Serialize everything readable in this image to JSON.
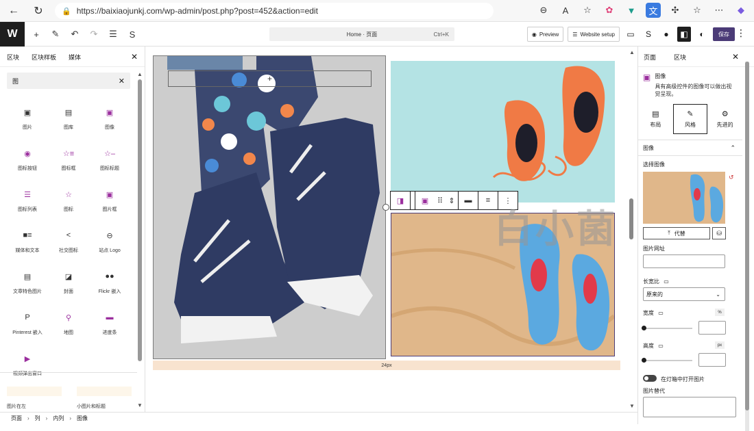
{
  "browser": {
    "url": "https://baixiaojunkj.com/wp-admin/post.php?post=452&action=edit"
  },
  "wp_toolbar": {
    "doc_title": "Home · 页面",
    "shortcut": "Ctrl+K",
    "preview_label": "Preview",
    "website_setup_label": "Website setup",
    "save_label": "保存"
  },
  "left_panel": {
    "tabs": [
      "区块",
      "区块样板",
      "媒体"
    ],
    "search_value": "图",
    "blocks": [
      {
        "label": "图片",
        "icon": "image-icon"
      },
      {
        "label": "图库",
        "icon": "gallery-icon"
      },
      {
        "label": "图像",
        "icon": "image-pink-icon"
      },
      {
        "label": "图标按钮",
        "icon": "icon-button-icon"
      },
      {
        "label": "图标框",
        "icon": "icon-box-icon"
      },
      {
        "label": "图标标题",
        "icon": "icon-heading-icon"
      },
      {
        "label": "图标列表",
        "icon": "icon-list-icon"
      },
      {
        "label": "图标",
        "icon": "star-icon"
      },
      {
        "label": "图片框",
        "icon": "image-box-icon"
      },
      {
        "label": "媒体和文本",
        "icon": "media-text-icon"
      },
      {
        "label": "社交图标",
        "icon": "share-icon"
      },
      {
        "label": "站点 Logo",
        "icon": "site-logo-icon"
      },
      {
        "label": "文章特色图片",
        "icon": "featured-image-icon"
      },
      {
        "label": "封面",
        "icon": "cover-icon"
      },
      {
        "label": "Flickr 嵌入",
        "icon": "flickr-icon"
      },
      {
        "label": "Pinterest 嵌入",
        "icon": "pinterest-icon"
      },
      {
        "label": "地图",
        "icon": "map-pin-icon"
      },
      {
        "label": "进度条",
        "icon": "progress-bar-icon"
      },
      {
        "label": "视频弹出窗口",
        "icon": "video-popup-icon"
      }
    ],
    "patterns": [
      "图片在左",
      "小图片和标题"
    ]
  },
  "breadcrumb": [
    "页面",
    "列",
    "内列",
    "图像"
  ],
  "canvas": {
    "spacer_label": "24px",
    "watermark": "白小菌"
  },
  "right_panel": {
    "tabs": [
      "页面",
      "区块"
    ],
    "block_title": "图像",
    "block_desc": "具有高级控件的图像可以做出视觉呈现。",
    "style_tabs": [
      {
        "label": "布局",
        "icon": "layout-icon"
      },
      {
        "label": "风格",
        "icon": "brush-icon"
      },
      {
        "label": "先进的",
        "icon": "gear-icon"
      }
    ],
    "section_title": "图像",
    "choose_image_label": "选择图像",
    "replace_label": "代替",
    "image_url_label": "图片网址",
    "aspect_ratio_label": "长宽比",
    "aspect_ratio_value": "原来的",
    "width_label": "宽度",
    "width_unit": "%",
    "height_label": "高度",
    "height_unit": "px",
    "lightbox_label": "在灯箱中打开图片",
    "alt_label": "图片替代"
  }
}
